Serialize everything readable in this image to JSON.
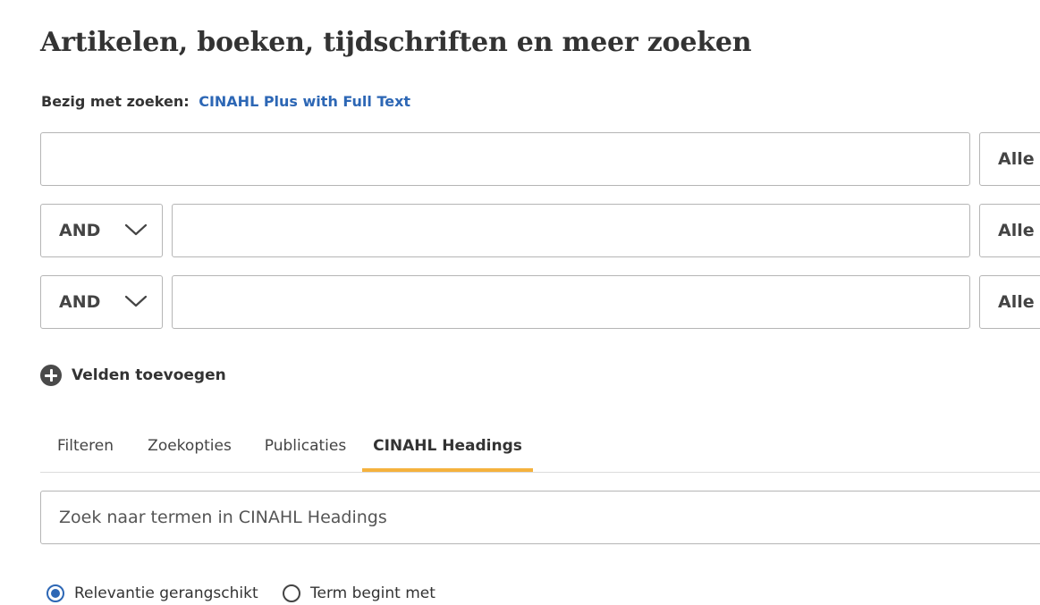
{
  "page": {
    "title": "Artikelen, boeken, tijdschriften en meer zoeken",
    "searching_label": "Bezig met zoeken:",
    "database_link": "CINAHL Plus with Full Text"
  },
  "search_rows": [
    {
      "operator": null,
      "value": "",
      "field": "Alle velden"
    },
    {
      "operator": "AND",
      "value": "",
      "field": "Alle velden"
    },
    {
      "operator": "AND",
      "value": "",
      "field": "Alle velden"
    }
  ],
  "add_fields_label": "Velden toevoegen",
  "tabs": [
    {
      "label": "Filteren",
      "active": false
    },
    {
      "label": "Zoekopties",
      "active": false
    },
    {
      "label": "Publicaties",
      "active": false
    },
    {
      "label": "CINAHL Headings",
      "active": true
    }
  ],
  "headings_search": {
    "placeholder": "Zoek naar termen in CINAHL Headings",
    "value": ""
  },
  "radio_options": [
    {
      "label": "Relevantie gerangschikt",
      "checked": true
    },
    {
      "label": "Term begint met",
      "checked": false
    }
  ],
  "colors": {
    "link": "#2d67b5",
    "active_tab_underline": "#f5b23d",
    "radio_checked": "#2d67b5"
  },
  "icons": [
    "chevron-down-icon",
    "plus-circle-icon"
  ]
}
